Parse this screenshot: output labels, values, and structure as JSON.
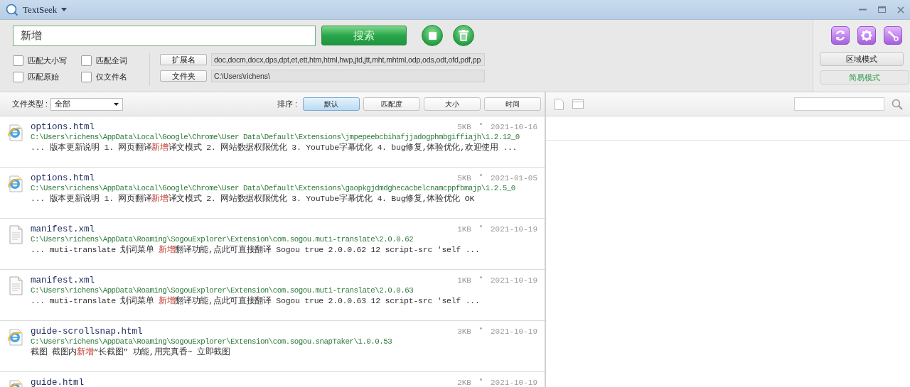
{
  "window": {
    "title": "TextSeek"
  },
  "search": {
    "value": "新增",
    "button": "搜索"
  },
  "options": [
    {
      "label": "匹配大小写",
      "checked": false
    },
    {
      "label": "匹配全词",
      "checked": false
    },
    {
      "label": "匹配原始",
      "checked": false
    },
    {
      "label": "仅文件名",
      "checked": false
    }
  ],
  "filters": [
    {
      "label": "扩展名",
      "value": "doc,docm,docx,dps,dpt,et,ett,htm,html,hwp,jtd,jtt,mht,mhtml,odp,ods,odt,ofd,pdf,pp"
    },
    {
      "label": "文件夹",
      "value": "C:\\Users\\richens\\"
    }
  ],
  "modes": [
    {
      "label": "区域模式",
      "selected": false
    },
    {
      "label": "简易模式",
      "selected": true
    }
  ],
  "file_type": {
    "label": "文件类型 :",
    "value": "全部"
  },
  "sort": {
    "label": "排序 :",
    "options": [
      {
        "label": "默认",
        "selected": true
      },
      {
        "label": "匹配度",
        "selected": false
      },
      {
        "label": "大小",
        "selected": false
      },
      {
        "label": "时间",
        "selected": false
      }
    ]
  },
  "results": [
    {
      "kind": "html",
      "name": "options.html",
      "path": "C:\\Users\\richens\\AppData\\Local\\Google\\Chrome\\User Data\\Default\\Extensions\\jmpepeebcbihafjjadogphmbgiffiajh\\1.2.12_0",
      "snippet": [
        {
          "text": "... 版本更新说明 1. 网页翻译",
          "match": false
        },
        {
          "text": "新增",
          "match": true
        },
        {
          "text": "译文模式 2. 网站数据权限优化 3. YouTube字幕优化 4. bug修复,体验优化,欢迎使用 ...",
          "match": false
        }
      ],
      "size": "5KB",
      "date": "2021-10-16"
    },
    {
      "kind": "html",
      "name": "options.html",
      "path": "C:\\Users\\richens\\AppData\\Local\\Google\\Chrome\\User Data\\Default\\Extensions\\gaopkgjdmdghecacbelcnamcppfbmajp\\1.2.5_0",
      "snippet": [
        {
          "text": "... 版本更新说明 1. 网页翻译",
          "match": false
        },
        {
          "text": "新增",
          "match": true
        },
        {
          "text": "译文模式 2. 网站数据权限优化 3. YouTube字幕优化 4. Bug修复,体验优化 OK",
          "match": false
        }
      ],
      "size": "5KB",
      "date": "2021-01-05"
    },
    {
      "kind": "xml",
      "name": "manifest.xml",
      "path": "C:\\Users\\richens\\AppData\\Roaming\\SogouExplorer\\Extension\\com.sogou.muti-translate\\2.0.0.62",
      "snippet": [
        {
          "text": "... muti-translate 划词菜单 ",
          "match": false
        },
        {
          "text": "新增",
          "match": true
        },
        {
          "text": "翻译功能,点此可直接翻译 Sogou true 2.0.0.62 12 script-src 'self ...",
          "match": false
        }
      ],
      "size": "1KB",
      "date": "2021-10-19"
    },
    {
      "kind": "xml",
      "name": "manifest.xml",
      "path": "C:\\Users\\richens\\AppData\\Roaming\\SogouExplorer\\Extension\\com.sogou.muti-translate\\2.0.0.63",
      "snippet": [
        {
          "text": "... muti-translate 划词菜单 ",
          "match": false
        },
        {
          "text": "新增",
          "match": true
        },
        {
          "text": "翻译功能,点此可直接翻译 Sogou true 2.0.0.63 12 script-src 'self ...",
          "match": false
        }
      ],
      "size": "1KB",
      "date": "2021-10-19"
    },
    {
      "kind": "html",
      "name": "guide-scrollsnap.html",
      "path": "C:\\Users\\richens\\AppData\\Roaming\\SogouExplorer\\Extension\\com.sogou.snapTaker\\1.0.0.53",
      "snippet": [
        {
          "text": "截图 截图内",
          "match": false
        },
        {
          "text": "新增",
          "match": true
        },
        {
          "text": "“长截图” 功能,用完真香~ 立即截图",
          "match": false
        }
      ],
      "size": "3KB",
      "date": "2021-10-19"
    },
    {
      "kind": "html",
      "name": "guide.html",
      "size": "2KB",
      "date": "2021-10-19"
    }
  ]
}
